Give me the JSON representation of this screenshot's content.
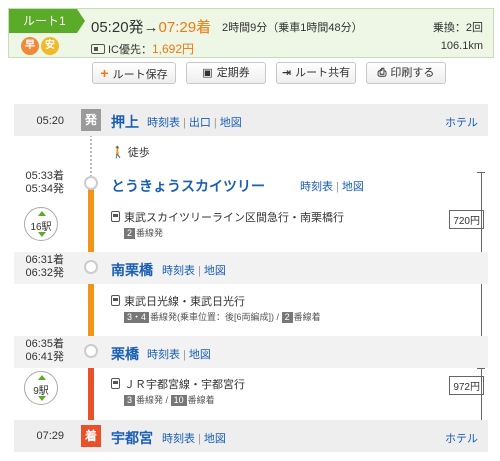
{
  "summary": {
    "route_label": "ルート1",
    "tag_fast": "早",
    "tag_cheap": "安",
    "depart": "05:20発",
    "arrow": "→",
    "arrive": "07:29着",
    "duration": "2時間9分（乗車1時間48分）",
    "fare_label": "IC優先：",
    "fare": "1,692円",
    "transfers": "乗換：2回",
    "distance": "106.1km"
  },
  "actions": {
    "save": "ルート保存",
    "pass": "定期券",
    "share": "ルート共有",
    "print": "印刷する"
  },
  "common": {
    "timetable": "時刻表",
    "exit": "出口",
    "map": "地図",
    "hotel": "ホテル",
    "sep": "|"
  },
  "stops": [
    {
      "time": "05:20",
      "marker": "発",
      "name": "押上"
    },
    {
      "time_arr": "05:33着",
      "time_dep": "05:34発",
      "name": "とうきょうスカイツリー"
    },
    {
      "time_arr": "06:31着",
      "time_dep": "06:32発",
      "name": "南栗橋"
    },
    {
      "time_arr": "06:35着",
      "time_dep": "06:41発",
      "name": "栗橋"
    },
    {
      "time": "07:29",
      "marker": "着",
      "name": "宇都宮"
    }
  ],
  "segments": [
    {
      "walk": "徒歩"
    },
    {
      "line": "東武スカイツリーライン区間急行・南栗橋行",
      "platform_dep": "2",
      "platform_dep_suffix": "番線発",
      "stops": "16駅",
      "fare": "720円"
    },
    {
      "line": "東武日光線・東武日光行",
      "platform_dep": "3・4",
      "platform_dep_suffix": "番線発(乗車位置：後[6両編成])",
      "platform_sep": "/",
      "platform_arr": "2",
      "platform_arr_suffix": "番線着"
    },
    {
      "line": "ＪＲ宇都宮線・宇都宮行",
      "platform_dep": "3",
      "platform_dep_suffix": "番線発",
      "platform_sep": "/",
      "platform_arr": "10",
      "platform_arr_suffix": "番線着",
      "stops": "9駅",
      "fare": "972円"
    }
  ],
  "colors": {
    "accent_green": "#5aac28",
    "orange_line": "#f39318",
    "red_line": "#e8512a",
    "link_blue": "#1a5fb4"
  }
}
